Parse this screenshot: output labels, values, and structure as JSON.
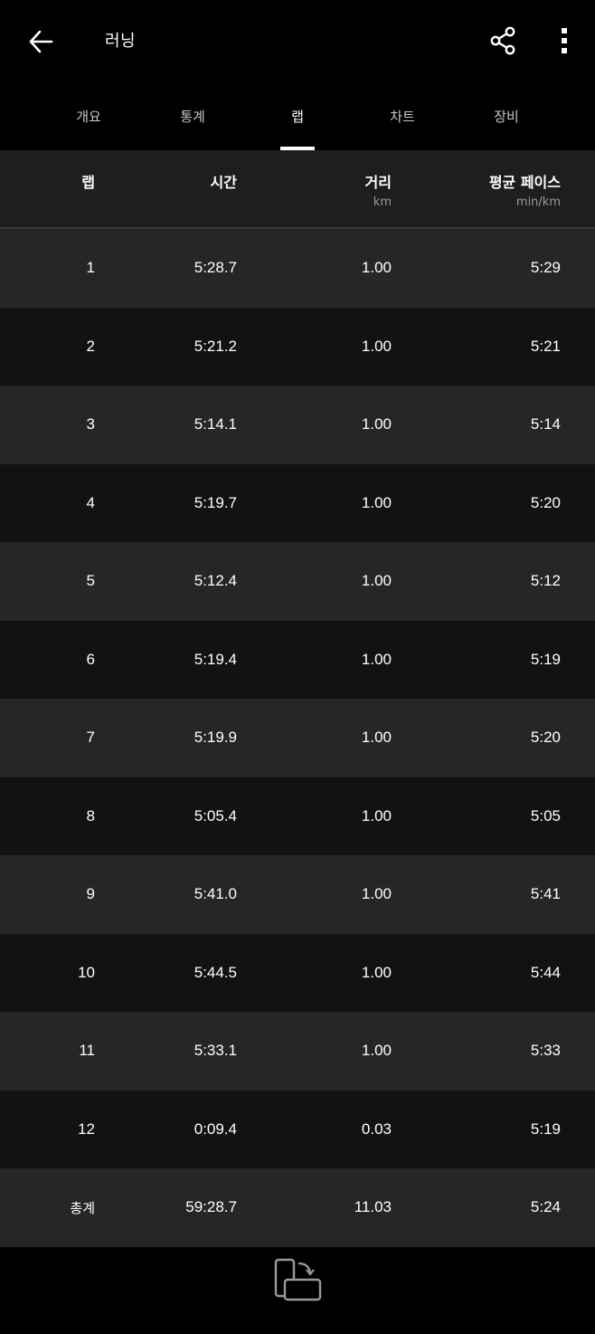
{
  "header": {
    "title": "러닝",
    "back_icon": "arrow-left-icon",
    "share_icon": "share-icon",
    "more_icon": "more-vertical-icon"
  },
  "tabs": [
    {
      "label": "개요",
      "active": false
    },
    {
      "label": "통계",
      "active": false
    },
    {
      "label": "랩",
      "active": true
    },
    {
      "label": "차트",
      "active": false
    },
    {
      "label": "장비",
      "active": false
    }
  ],
  "table": {
    "columns": [
      {
        "label": "랩",
        "unit": ""
      },
      {
        "label": "시간",
        "unit": ""
      },
      {
        "label": "거리",
        "unit": "km"
      },
      {
        "label": "평균 페이스",
        "unit": "min/km"
      }
    ],
    "rows": [
      {
        "lap": "1",
        "time": "5:28.7",
        "distance": "1.00",
        "pace": "5:29"
      },
      {
        "lap": "2",
        "time": "5:21.2",
        "distance": "1.00",
        "pace": "5:21"
      },
      {
        "lap": "3",
        "time": "5:14.1",
        "distance": "1.00",
        "pace": "5:14"
      },
      {
        "lap": "4",
        "time": "5:19.7",
        "distance": "1.00",
        "pace": "5:20"
      },
      {
        "lap": "5",
        "time": "5:12.4",
        "distance": "1.00",
        "pace": "5:12"
      },
      {
        "lap": "6",
        "time": "5:19.4",
        "distance": "1.00",
        "pace": "5:19"
      },
      {
        "lap": "7",
        "time": "5:19.9",
        "distance": "1.00",
        "pace": "5:20"
      },
      {
        "lap": "8",
        "time": "5:05.4",
        "distance": "1.00",
        "pace": "5:05"
      },
      {
        "lap": "9",
        "time": "5:41.0",
        "distance": "1.00",
        "pace": "5:41"
      },
      {
        "lap": "10",
        "time": "5:44.5",
        "distance": "1.00",
        "pace": "5:44"
      },
      {
        "lap": "11",
        "time": "5:33.1",
        "distance": "1.00",
        "pace": "5:33"
      },
      {
        "lap": "12",
        "time": "0:09.4",
        "distance": "0.03",
        "pace": "5:19"
      }
    ],
    "total": {
      "label": "총계",
      "time": "59:28.7",
      "distance": "11.03",
      "pace": "5:24"
    }
  },
  "bottom": {
    "rotate_icon": "screen-rotate-icon"
  },
  "colors": {
    "background": "#000000",
    "row_light": "#262626",
    "row_dark": "#121212",
    "header_bg": "#1e1e1e",
    "text": "#ffffff",
    "muted": "#9a9a9a"
  }
}
